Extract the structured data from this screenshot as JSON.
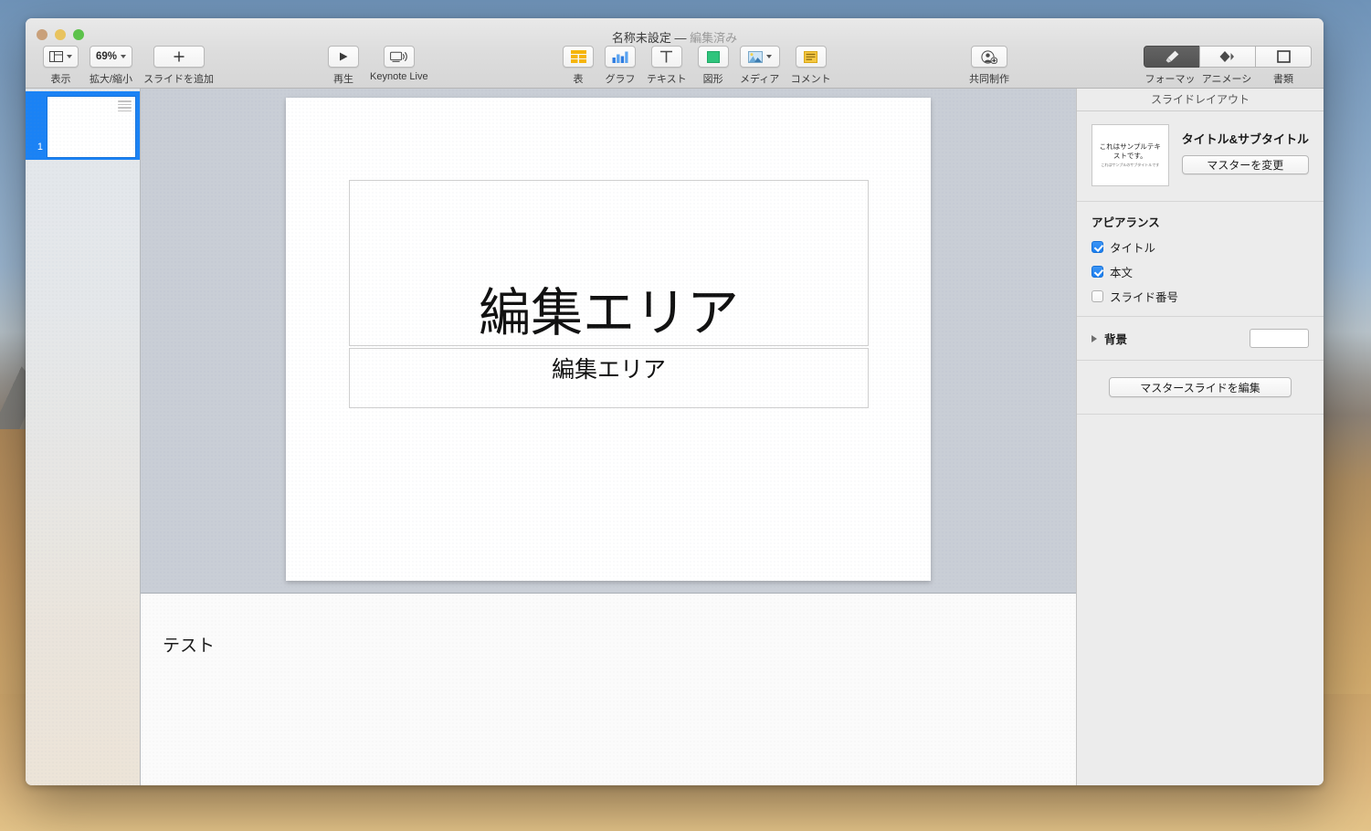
{
  "window": {
    "title_main": "名称未設定",
    "title_sep": " — ",
    "title_status": "編集済み",
    "traffic": {
      "close": "close-button",
      "minimize": "minimize-button",
      "zoom": "zoom-button"
    }
  },
  "toolbar": {
    "left": [
      {
        "name": "view",
        "label": "表示",
        "icon": "view-panes-icon",
        "has_chevron": true
      },
      {
        "name": "zoom",
        "label": "拡大/縮小",
        "value": "69%",
        "icon": "zoom-level",
        "has_chevron": true
      },
      {
        "name": "add-slide",
        "label": "スライドを追加",
        "icon": "plus-icon",
        "has_chevron": false
      }
    ],
    "play": [
      {
        "name": "play",
        "label": "再生",
        "icon": "play-triangle-icon"
      },
      {
        "name": "keynote-live",
        "label": "Keynote Live",
        "icon": "display-broadcast-icon"
      }
    ],
    "insert": [
      {
        "name": "table",
        "label": "表",
        "icon": "table-grid-icon",
        "color": "#f5b50a"
      },
      {
        "name": "chart",
        "label": "グラフ",
        "icon": "bar-chart-icon",
        "color": "#2f7de1"
      },
      {
        "name": "text",
        "label": "テキスト",
        "icon": "text-t-icon",
        "color": "#555555"
      },
      {
        "name": "shape",
        "label": "図形",
        "icon": "shape-square-icon",
        "color": "#2fc47c"
      },
      {
        "name": "media",
        "label": "メディア",
        "icon": "photo-icon",
        "has_chevron": true
      },
      {
        "name": "comment",
        "label": "コメント",
        "icon": "comment-lines-icon",
        "color": "#f5b50a"
      }
    ],
    "collaborate": {
      "name": "collaborate",
      "label": "共同制作",
      "icon": "person-add-icon"
    },
    "segmented": [
      {
        "name": "format",
        "label": "フォーマット",
        "icon": "paintbrush-icon",
        "active": true
      },
      {
        "name": "animate",
        "label": "アニメーション",
        "icon": "diamond-motion-icon",
        "active": false
      },
      {
        "name": "document",
        "label": "書類",
        "icon": "document-frame-icon",
        "active": false
      }
    ]
  },
  "navigator": {
    "slides": [
      {
        "number": "1",
        "selected": true,
        "name": "slide-thumbnail-1"
      }
    ]
  },
  "canvas": {
    "slide": {
      "title_placeholder": "編集エリア",
      "subtitle_placeholder": "編集エリア"
    }
  },
  "notes": {
    "text": "テスト"
  },
  "inspector": {
    "header": "スライドレイアウト",
    "master": {
      "thumb_title": "これはサンプルテキストです。",
      "thumb_sub": "これはサンプルのサブタイトルです",
      "name": "タイトル&サブタイトル",
      "change_button": "マスターを変更"
    },
    "appearance": {
      "title": "アピアランス",
      "options": [
        {
          "label": "タイトル",
          "checked": true,
          "name": "checkbox-title"
        },
        {
          "label": "本文",
          "checked": true,
          "name": "checkbox-body"
        },
        {
          "label": "スライド番号",
          "checked": false,
          "name": "checkbox-slide-number"
        }
      ]
    },
    "background": {
      "label": "背景",
      "swatch_color": "#ffffff"
    },
    "edit_master_button": "マスタースライドを編集"
  },
  "colors": {
    "accent_blue": "#1a82f5",
    "canvas_bg": "#c9ced6",
    "toolbar_bg": "#dddddd",
    "inspector_bg": "#ececec"
  }
}
